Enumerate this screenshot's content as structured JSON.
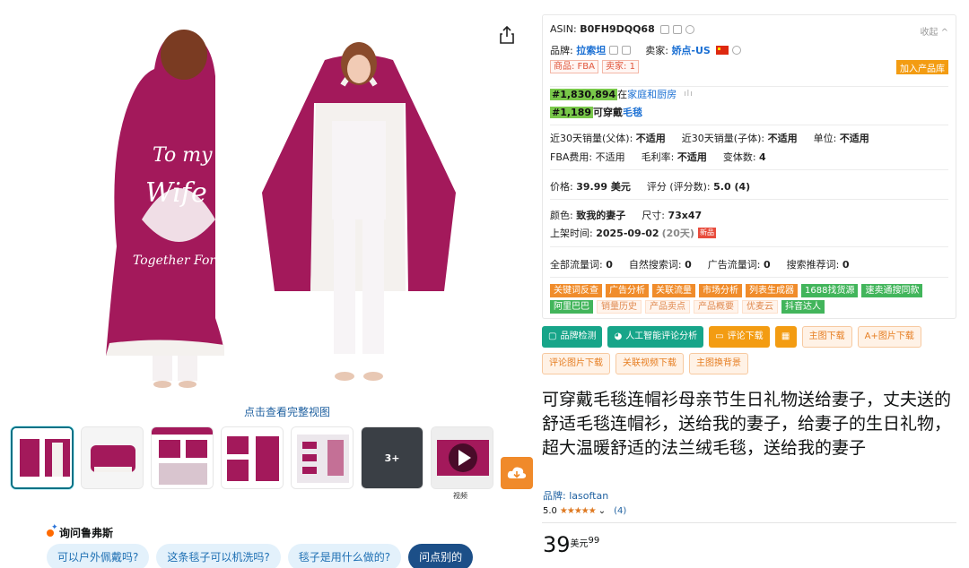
{
  "gallery": {
    "full_view_link": "点击查看完整视图",
    "more_label": "3+",
    "video_caption": "视频"
  },
  "ask": {
    "title": "询问鲁弗斯",
    "chips": [
      "可以户外佩戴吗?",
      "这条毯子可以机洗吗?",
      "毯子是用什么做的?",
      "问点别的"
    ]
  },
  "panel": {
    "asin_label": "ASIN:",
    "asin": "B0FH9DQQ68",
    "collapse": "收起",
    "brand_label": "品牌:",
    "brand": "拉索坦",
    "seller_label": "卖家:",
    "seller": "娇点-US",
    "tag_product": "商品: FBA",
    "tag_seller": "卖家: 1",
    "add_library": "加入产品库",
    "rank1_num": "#1,830,894",
    "rank1_in": "在",
    "rank1_cat": "家庭和厨房",
    "rank2_num": "#1,189",
    "rank2_cat_prefix": "可穿戴",
    "rank2_cat": "毛毯",
    "sales_parent_label": "近30天销量(父体):",
    "sales_parent": "不适用",
    "sales_child_label": "近30天销量(子体):",
    "sales_child": "不适用",
    "unit_label": "单位:",
    "unit": "不适用",
    "fba_fee_label": "FBA费用:",
    "fba_fee": "不适用",
    "margin_label": "毛利率:",
    "margin": "不适用",
    "variants_label": "变体数:",
    "variants": "4",
    "price_label": "价格:",
    "price": "39.99 美元",
    "rating_label": "评分 (评分数):",
    "rating": "5.0 (4)",
    "color_label": "颜色:",
    "color": "致我的妻子",
    "size_label": "尺寸:",
    "size": "73x47",
    "listed_label": "上架时间:",
    "listed_date": "2025-09-02",
    "listed_days": "(20天)",
    "new_badge": "新品",
    "traffic_all_label": "全部流量词:",
    "traffic_all": "0",
    "traffic_natural_label": "自然搜索词:",
    "traffic_natural": "0",
    "traffic_ad_label": "广告流量词:",
    "traffic_ad": "0",
    "traffic_rec_label": "搜索推荐词:",
    "traffic_rec": "0",
    "tool_tags": [
      {
        "label": "关键词反查",
        "style": "orange"
      },
      {
        "label": "广告分析",
        "style": "orange"
      },
      {
        "label": "关联流量",
        "style": "orange"
      },
      {
        "label": "市场分析",
        "style": "orange"
      },
      {
        "label": "列表生成器",
        "style": "orange"
      },
      {
        "label": "1688找货源",
        "style": "green"
      },
      {
        "label": "速卖通搜同款",
        "style": "green"
      },
      {
        "label": "阿里巴巴",
        "style": "green"
      },
      {
        "label": "销量历史",
        "style": "ghost"
      },
      {
        "label": "产品卖点",
        "style": "ghost"
      },
      {
        "label": "产品概要",
        "style": "ghost"
      },
      {
        "label": "优麦云",
        "style": "ghost"
      },
      {
        "label": "抖音达人",
        "style": "green"
      }
    ]
  },
  "actions": {
    "check": "品牌检测",
    "ai_review": "人工智能评论分析",
    "review_download": "评论下载",
    "main_image_download": "主图下载",
    "aplus_download": "A+图片下载",
    "review_image_download": "评论图片下载",
    "video_download": "关联视频下载",
    "replace_bg": "主图换背景"
  },
  "product": {
    "title": "可穿戴毛毯连帽衫母亲节生日礼物送给妻子，丈夫送的舒适毛毯连帽衫，送给我的妻子，给妻子的生日礼物，超大温暖舒适的法兰绒毛毯，送给我的妻子",
    "brand": "品牌: lasoftan",
    "rating_value": "5.0",
    "stars": "★★★★★",
    "rating_count": "(4)",
    "price_whole": "39",
    "price_currency": "美元",
    "price_fraction": "99"
  },
  "colors": {
    "blanket": "#a3195b",
    "fleece": "#f4f1ee",
    "accent_teal": "#17a589",
    "accent_orange": "#f39c12",
    "link_blue": "#2162a1"
  }
}
